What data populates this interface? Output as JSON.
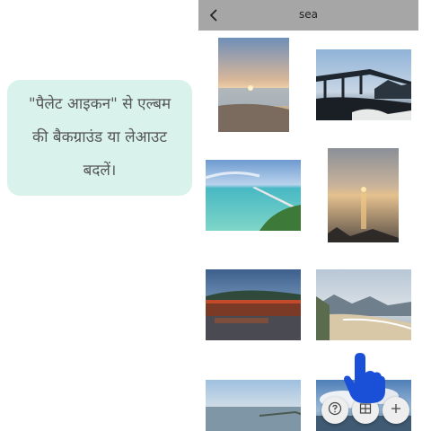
{
  "tooltip": {
    "text": "\"पैलेट आइकन\" से एल्बम की बैकग्राउंड या लेआउट बदलें।"
  },
  "appbar": {
    "title": "sea",
    "back_icon": "arrow-left-icon"
  },
  "photos": [
    {
      "description_icon": "sunset-beach-photo"
    },
    {
      "description_icon": "bridge-silhouette-photo"
    },
    {
      "description_icon": "pier-tropical-sea-photo"
    },
    {
      "description_icon": "sunset-reflection-photo"
    },
    {
      "description_icon": "floating-shrine-photo"
    },
    {
      "description_icon": "coastline-mountains-photo"
    },
    {
      "description_icon": "hazy-sea-photo"
    },
    {
      "description_icon": "cloudy-sky-sea-photo"
    }
  ],
  "fabs": {
    "help_icon": "help-circle-icon",
    "palette_icon": "grid-palette-icon",
    "add_icon": "plus-icon"
  },
  "colors": {
    "tooltip_bg": "#d9f3ec",
    "appbar_bg": "#a6a6a6",
    "pointer_hand": "#1a4fd8"
  }
}
